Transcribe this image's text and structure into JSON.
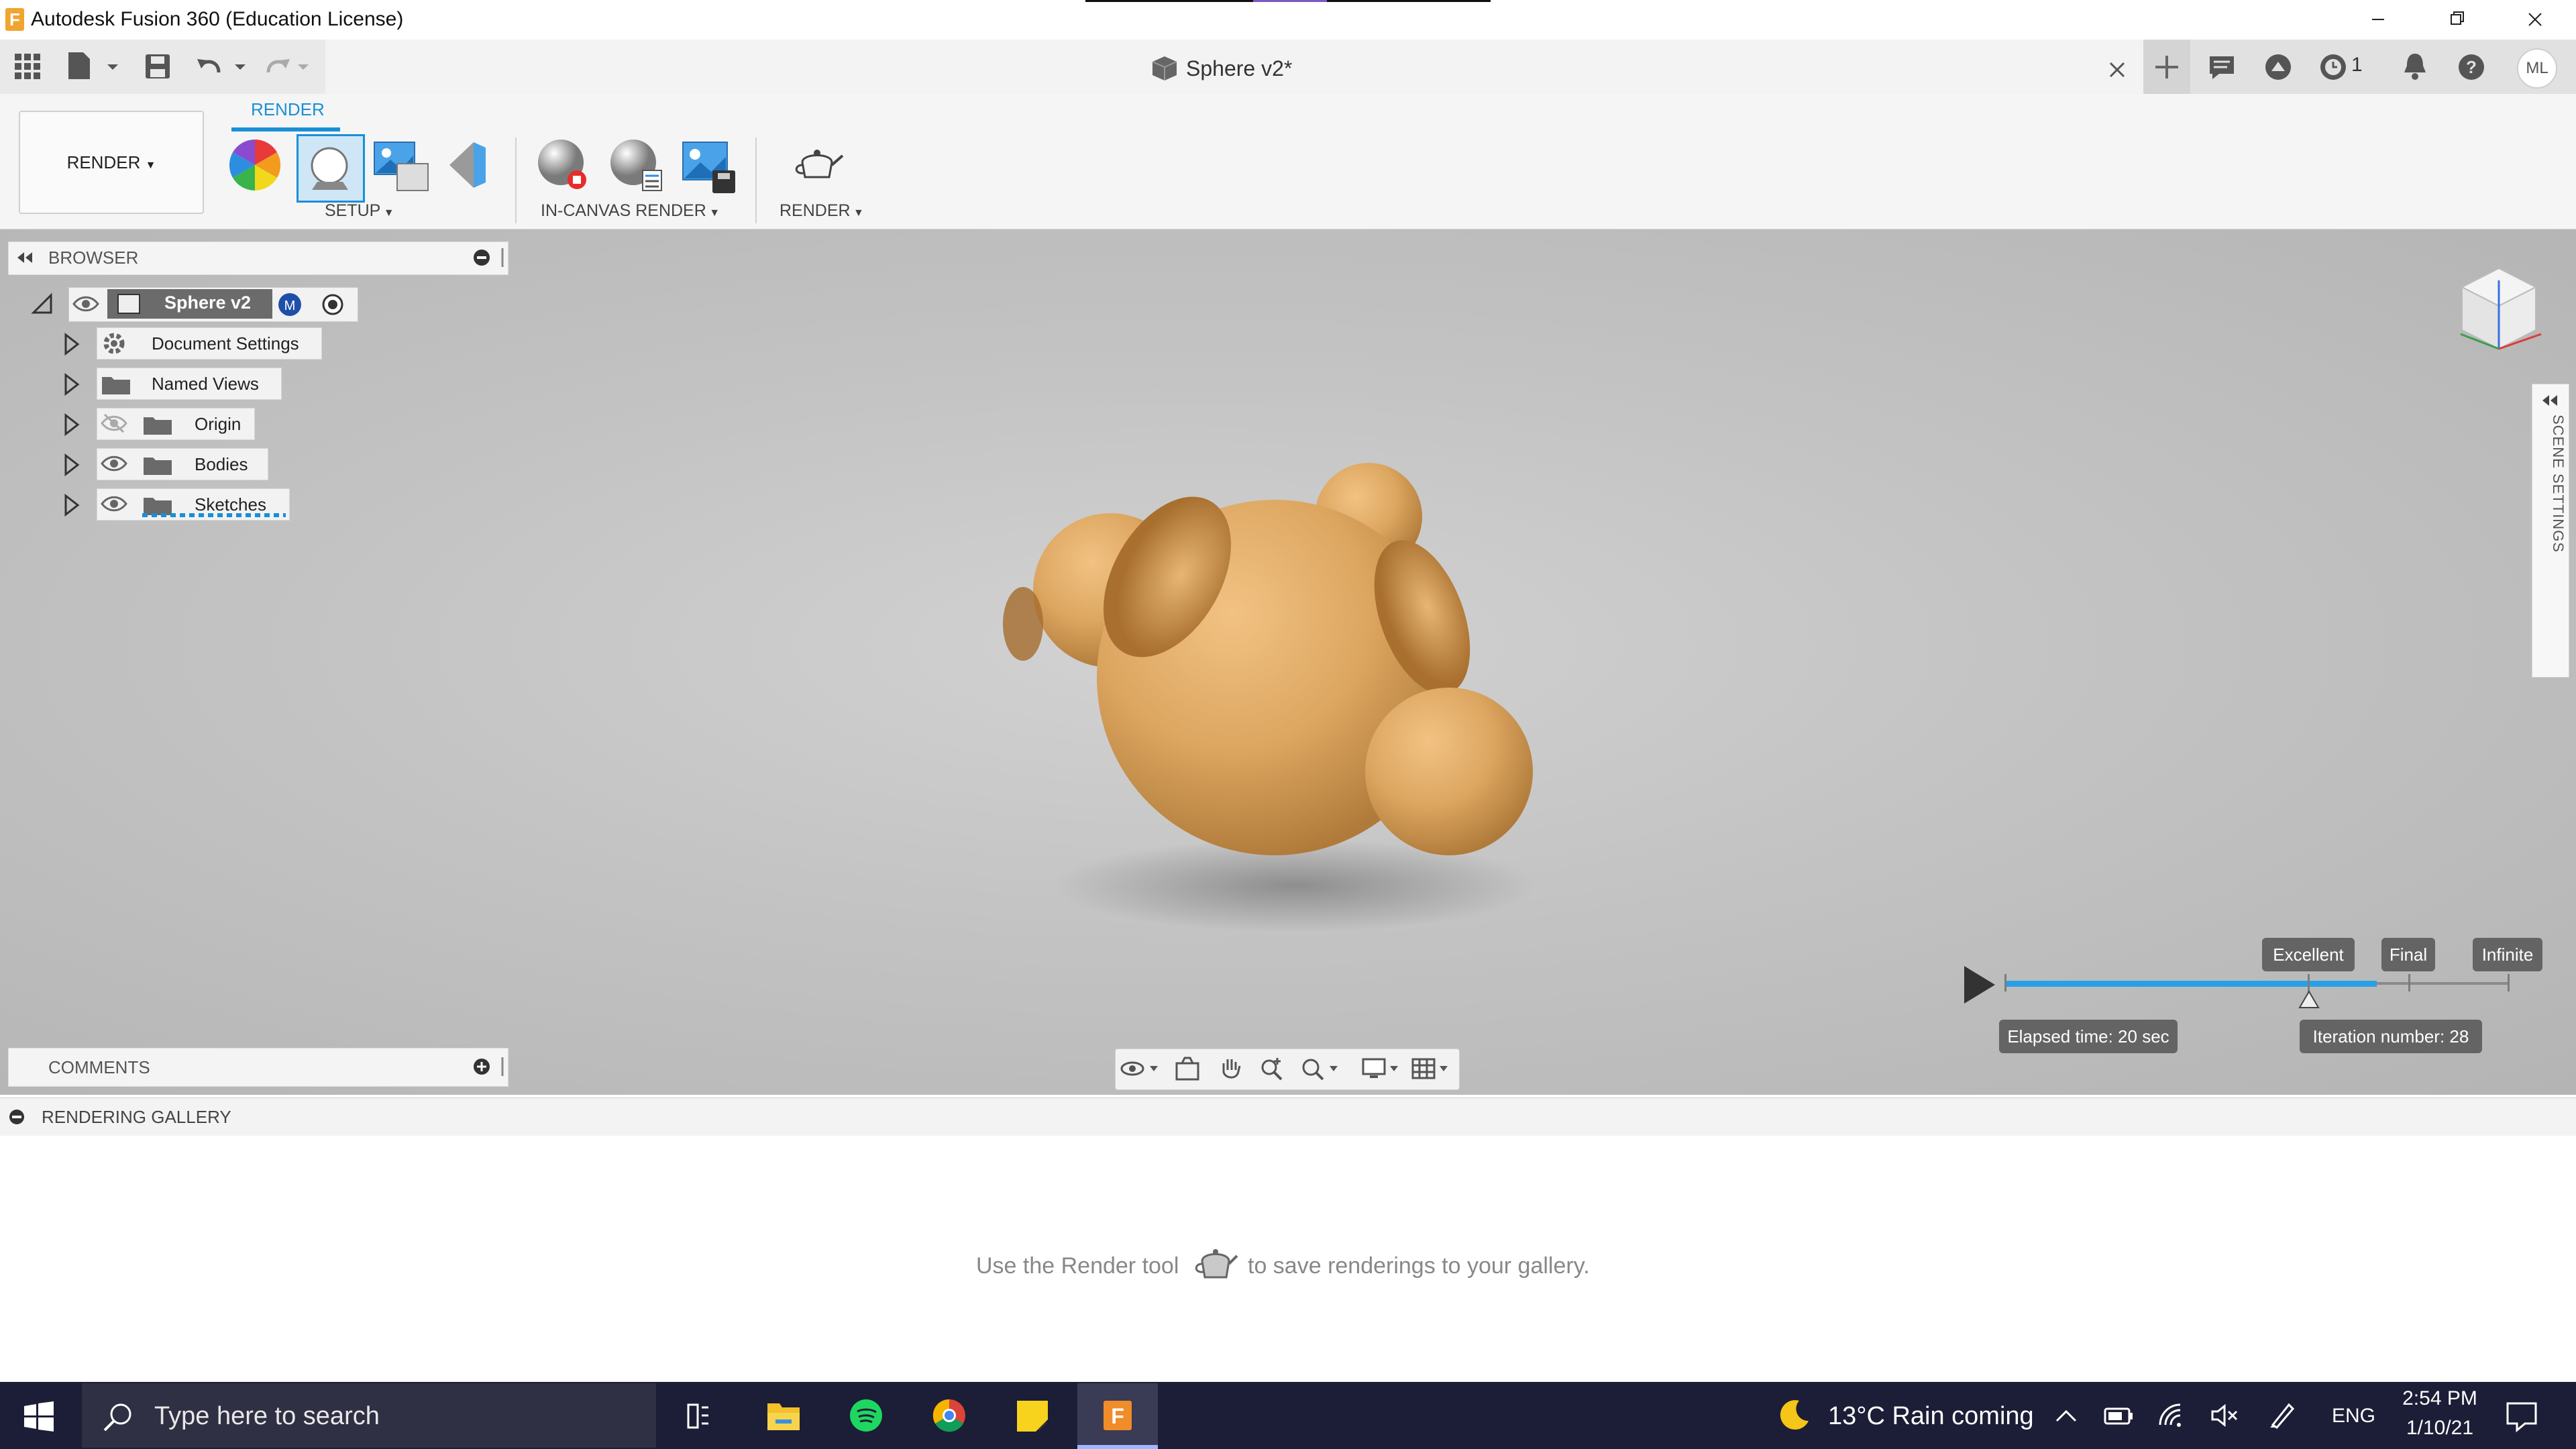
{
  "window": {
    "title": "Autodesk Fusion 360 (Education License)",
    "app_icon_letter": "F",
    "controls": [
      "minimize-icon",
      "restore-icon",
      "close-icon"
    ]
  },
  "document_tab": {
    "title": "Sphere v2*",
    "close_icon": "close-icon"
  },
  "toolbar_right": {
    "job_status_count": "1",
    "user_initials": "ML"
  },
  "ribbon": {
    "workspace_label": "RENDER",
    "active_tab": "RENDER",
    "groups": [
      {
        "label": "SETUP",
        "tools": [
          "scene-settings-icon",
          "appearance-icon",
          "texture-map-icon",
          "render-settings-icon"
        ]
      },
      {
        "label": "IN-CANVAS RENDER",
        "tools": [
          "stop-render-icon",
          "in-canvas-settings-icon",
          "capture-image-icon"
        ]
      },
      {
        "label": "RENDER",
        "tools": [
          "render-teapot-icon"
        ]
      }
    ]
  },
  "browser": {
    "title": "BROWSER",
    "root": "Sphere v2",
    "items": [
      {
        "label": "Document Settings",
        "icon": "gear-icon"
      },
      {
        "label": "Named Views",
        "icon": "folder-icon"
      },
      {
        "label": "Origin",
        "icon": "folder-icon",
        "visible": false
      },
      {
        "label": "Bodies",
        "icon": "folder-icon",
        "visible": true
      },
      {
        "label": "Sketches",
        "icon": "folder-icon",
        "visible": true
      }
    ]
  },
  "comments": {
    "title": "COMMENTS"
  },
  "scene_settings": {
    "label": "SCENE SETTINGS"
  },
  "render_progress": {
    "quality_levels": [
      "Excellent",
      "Final",
      "Infinite"
    ],
    "elapsed": "Elapsed time: 20 sec",
    "iteration": "Iteration number: 28",
    "progress_fraction": 0.74
  },
  "gallery": {
    "title": "RENDERING GALLERY",
    "hint_before": "Use the Render tool",
    "hint_after": "to save renderings to your gallery."
  },
  "taskbar": {
    "search_placeholder": "Type here to search",
    "apps": [
      "task-view-icon",
      "file-explorer-icon",
      "spotify-icon",
      "chrome-icon",
      "sticky-notes-icon",
      "fusion-360-icon"
    ],
    "weather": "13°C  Rain coming",
    "language": "ENG",
    "time": "2:54 PM",
    "date": "1/10/21"
  },
  "colors": {
    "accent": "#1a8fd6",
    "viewport_bg": "#c3c3c3",
    "taskbar": "#1c1d36",
    "model_wood": "#d9a460"
  }
}
